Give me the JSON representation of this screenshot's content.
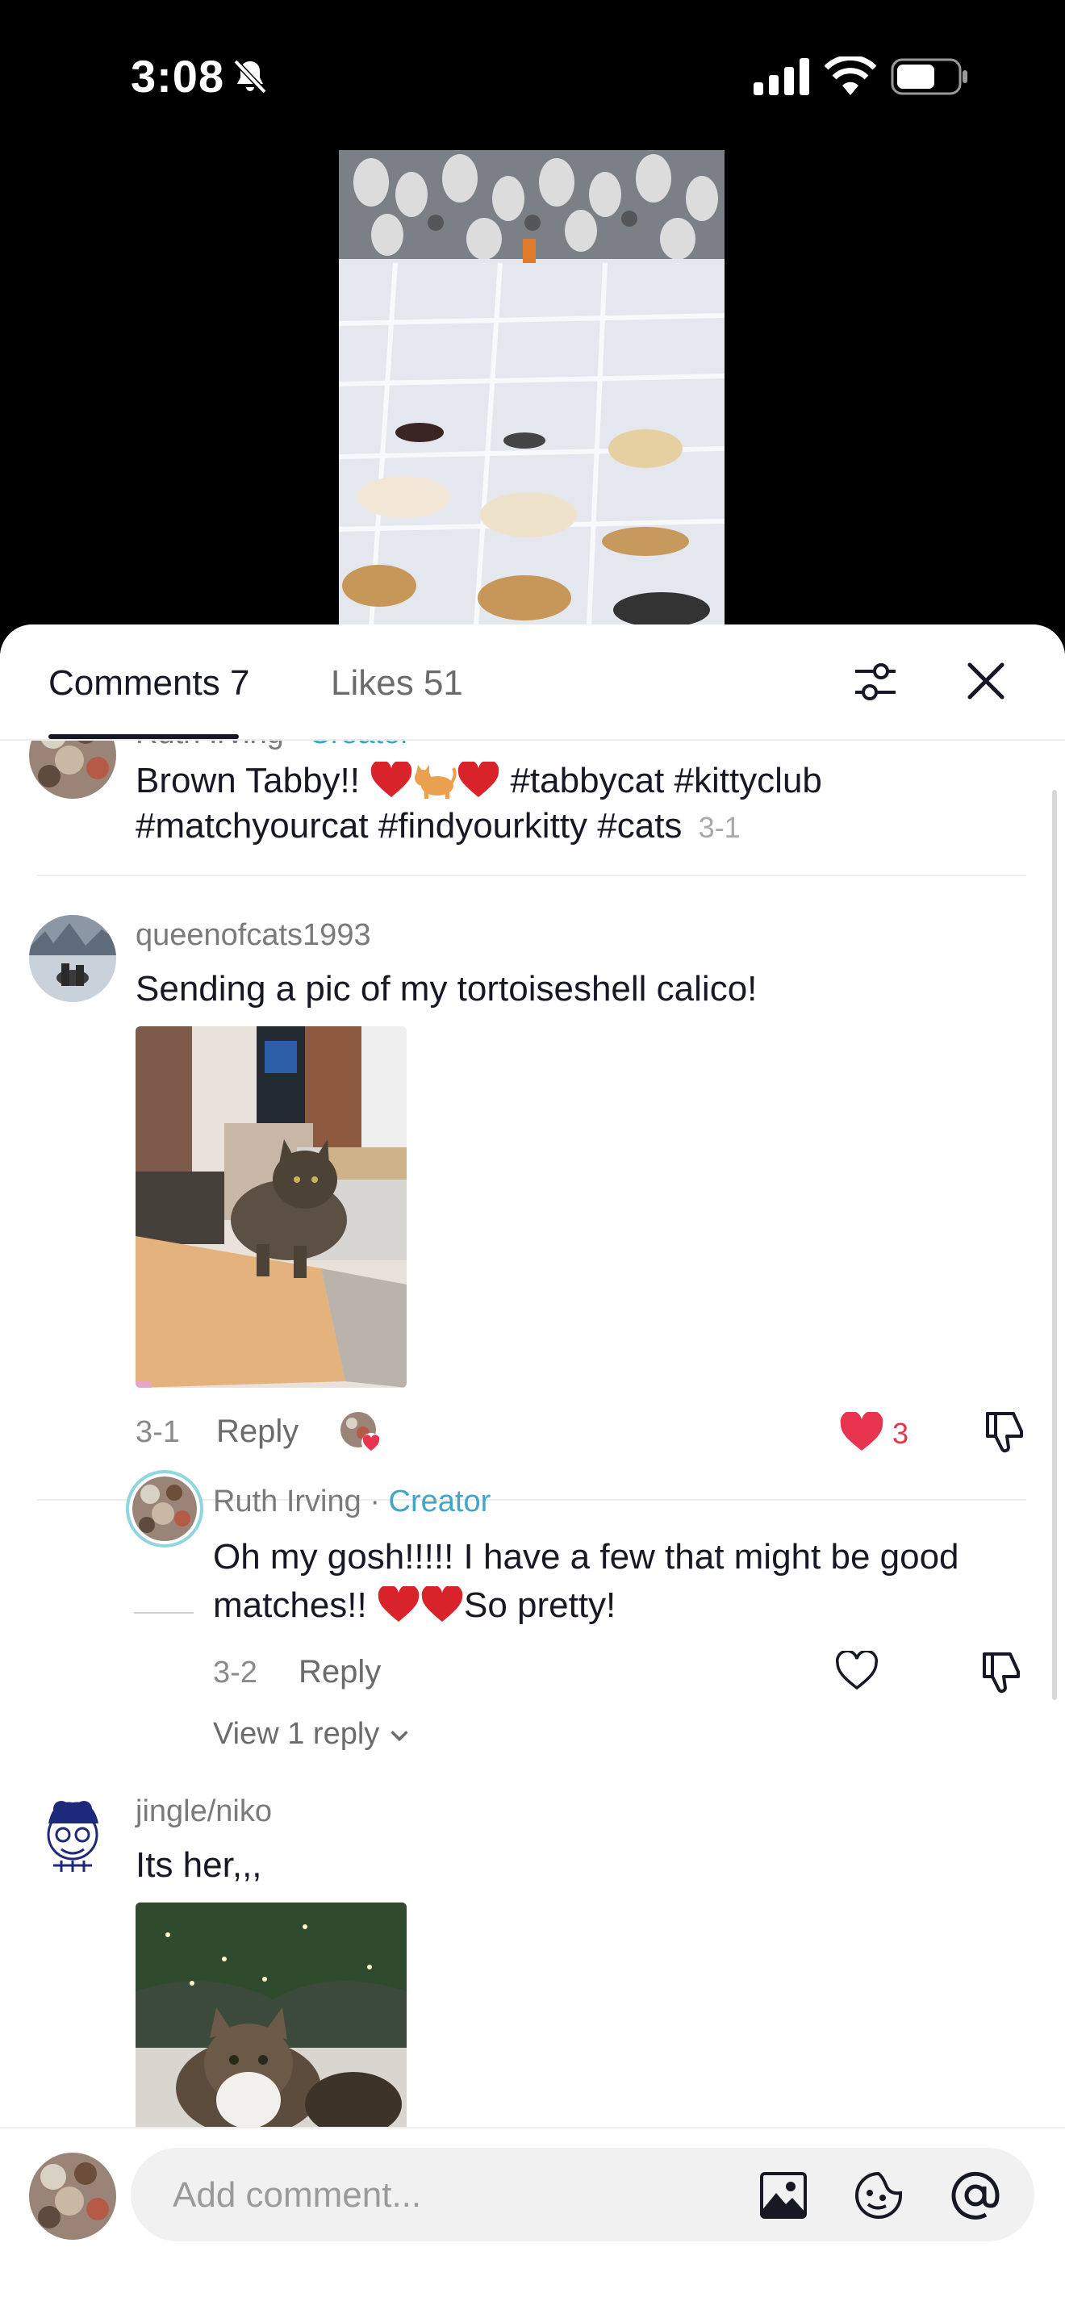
{
  "status_bar": {
    "time": "3:08",
    "icons": [
      "bell-slash-icon",
      "cellular-signal-icon",
      "wifi-icon",
      "battery-icon"
    ]
  },
  "sheet": {
    "tabs": [
      {
        "label": "Comments 7",
        "active": true
      },
      {
        "label": "Likes 51",
        "active": false
      }
    ],
    "icons": [
      "filter-icon",
      "close-icon"
    ]
  },
  "comments": [
    {
      "username": "Ruth Irving",
      "badge": "Creator",
      "text_start": "Brown Tabby!! ",
      "hashtags_line1": " #tabbycat #kittyclub",
      "hashtags_line2": "#matchyourcat #findyourkitty #cats",
      "date": "3-1"
    },
    {
      "username": "queenofcats1993",
      "text": "Sending a pic of my tortoiseshell calico!",
      "date": "3-1",
      "reply_label": "Reply",
      "likes": "3",
      "liked": true,
      "reply": {
        "username": "Ruth Irving",
        "separator": "·",
        "badge": "Creator",
        "text_line1": "Oh my gosh!!!!! I have a few that might be good",
        "text_line2_start": "matches!! ",
        "text_line2_end": "So pretty!",
        "date": "3-2",
        "reply_label": "Reply"
      },
      "view_replies": "View 1 reply"
    },
    {
      "username": "jingle/niko",
      "text": "Its her,,,"
    }
  ],
  "footer": {
    "placeholder": "Add comment...",
    "icons": [
      "image-icon",
      "emoji-icon",
      "mention-icon"
    ]
  },
  "colors": {
    "creator_badge": "#3fa6c7",
    "like_red": "#e8344e",
    "text_primary": "#161823"
  }
}
